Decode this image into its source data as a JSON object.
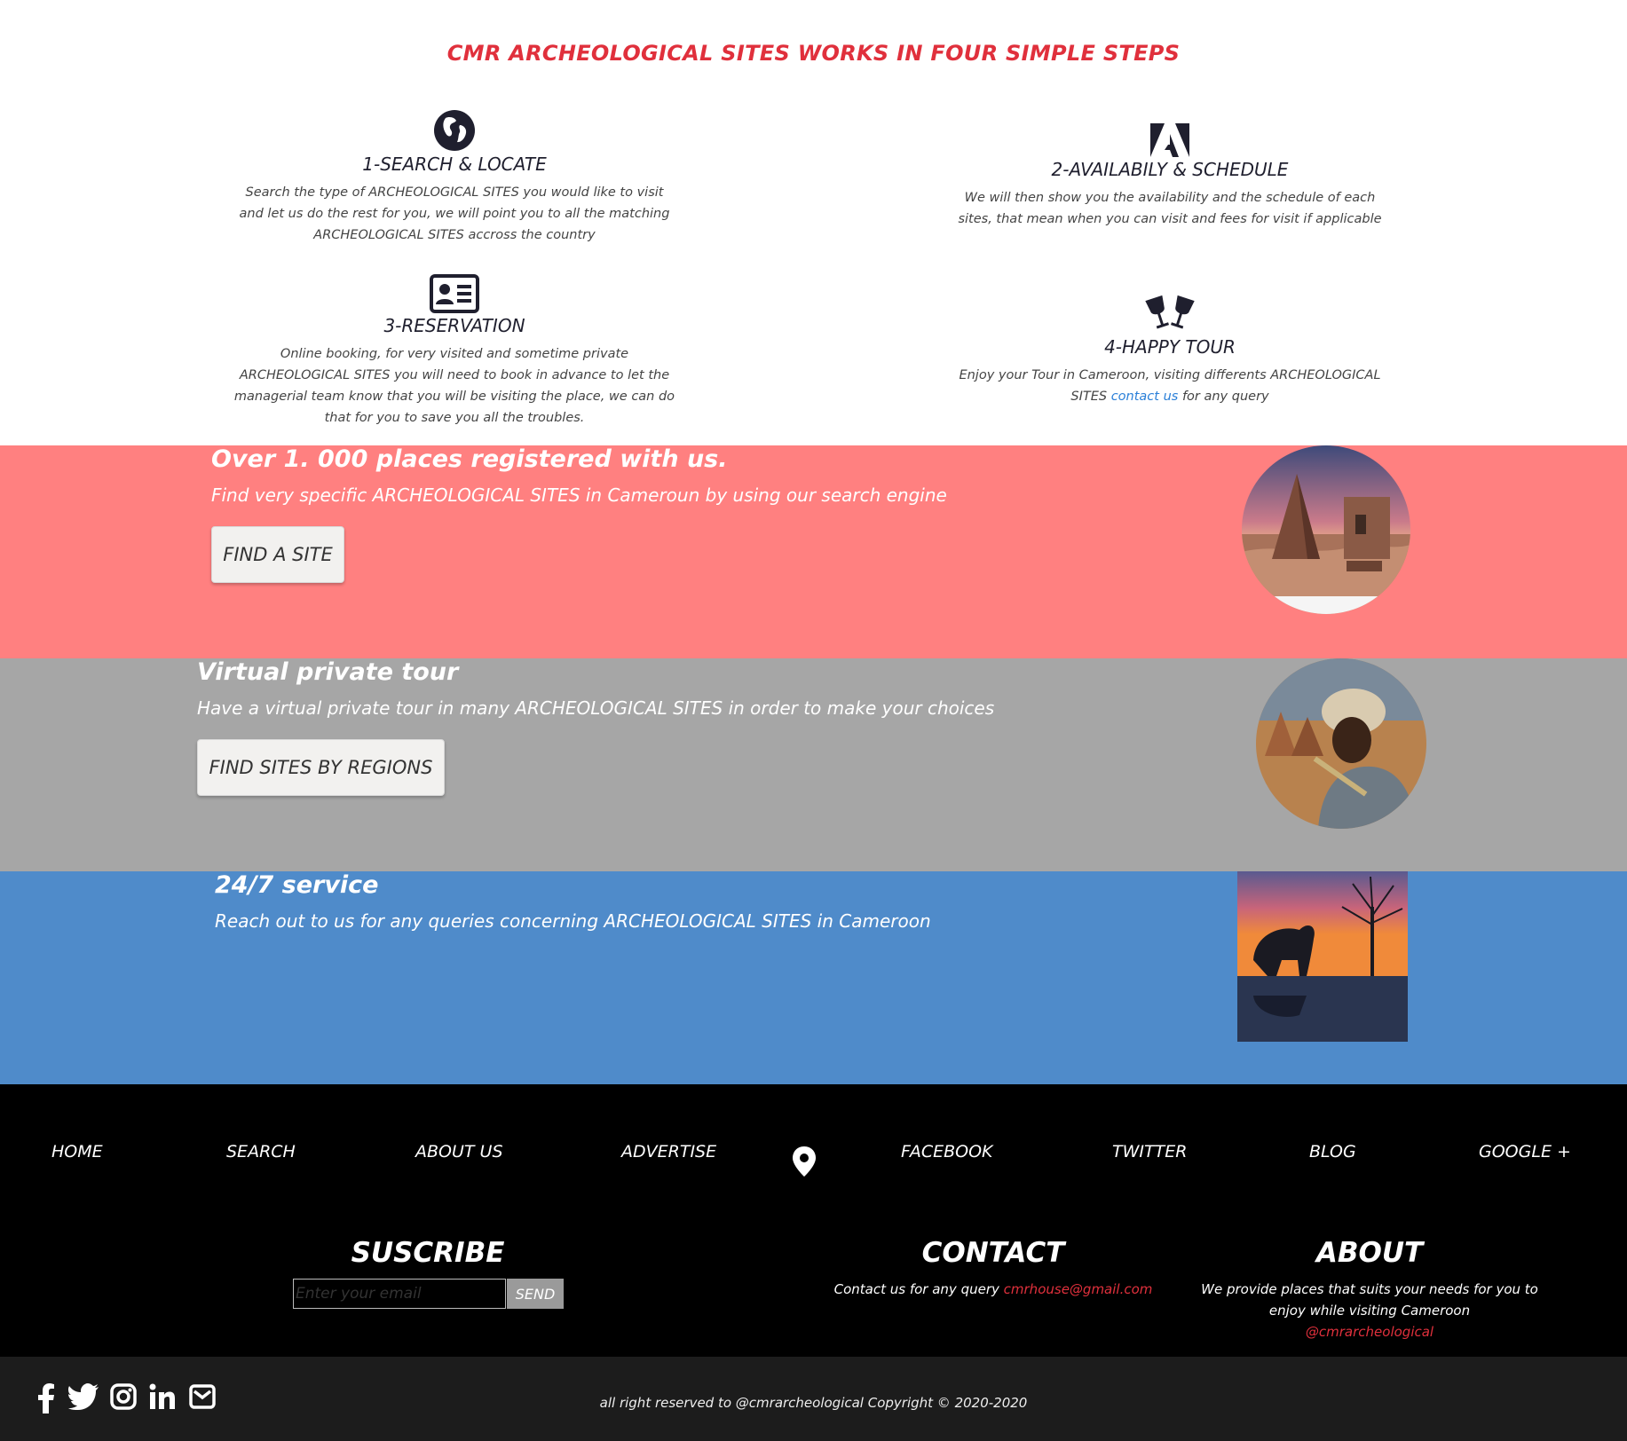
{
  "steps": {
    "title": "CMR ARCHEOLOGICAL SITES WORKS IN FOUR SIMPLE STEPS",
    "items": [
      {
        "icon": "globe-icon",
        "title": "1-SEARCH & LOCATE",
        "desc": "Search the type of ARCHEOLOGICAL SITES you would like to visit and let us do the rest for you, we will point you to all the matching ARCHEOLOGICAL SITES accross the country"
      },
      {
        "icon": "adobe-icon",
        "title": "2-AVAILABILY & SCHEDULE",
        "desc": "We will then show you the availability and the schedule of each sites, that mean when you can visit and fees for visit if applicable"
      },
      {
        "icon": "id-card-icon",
        "title": "3-RESERVATION",
        "desc": "Online booking, for very visited and sometime private ARCHEOLOGICAL SITES you will need to book in advance to let the managerial team know that you will be visiting the place, we can do that for you to save you all the troubles."
      },
      {
        "icon": "glasses-cheers-icon",
        "title": "4-HAPPY TOUR",
        "desc_before": "Enjoy your Tour in Cameroon, visiting differents ARCHEOLOGICAL SITES",
        "desc_link": "contact us",
        "desc_after": "for any query"
      }
    ]
  },
  "bands": [
    {
      "heading": "Over 1. 000 places registered with us.",
      "sub": "Find very specific ARCHEOLOGICAL SITES in Cameroun by using our search engine",
      "button": "FIND A SITE",
      "color": "#ff8080"
    },
    {
      "heading": "Virtual private tour",
      "sub": "Have a virtual private tour in many ARCHEOLOGICAL SITES in order to make your choices",
      "button": "FIND SITES BY REGIONS",
      "color": "#a6a6a6"
    },
    {
      "heading": "24/7 service",
      "sub": "Reach out to us for any queries concerning ARCHEOLOGICAL SITES in Cameroon",
      "color": "#4f8bca"
    }
  ],
  "footer": {
    "nav": [
      "HOME",
      "SEARCH",
      "ABOUT US",
      "ADVERTISE",
      "FACEBOOK",
      "TWITTER",
      "BLOG",
      "GOOGLE +"
    ],
    "subscribe": {
      "title": "SUSCRIBE",
      "placeholder": "Enter your email",
      "button": "SEND"
    },
    "contact": {
      "title": "CONTACT",
      "text": "Contact us for any query",
      "email": "cmrhouse@gmail.com"
    },
    "about": {
      "title": "ABOUT",
      "text": "We provide places that suits your needs for you to enjoy while visiting Cameroon",
      "handle": "@cmrarcheological"
    }
  },
  "bottom": {
    "copyright": "all right reserved to @cmrarcheological Copyright © 2020-2020",
    "social_icons": [
      "facebook-icon",
      "twitter-icon",
      "instagram-icon",
      "linkedin-icon",
      "envelope-icon"
    ]
  },
  "colors": {
    "accent_red": "#e0303c",
    "link_blue": "#2a7fd8",
    "band_red": "#ff8080",
    "band_grey": "#a6a6a6",
    "band_blue": "#4f8bca"
  }
}
